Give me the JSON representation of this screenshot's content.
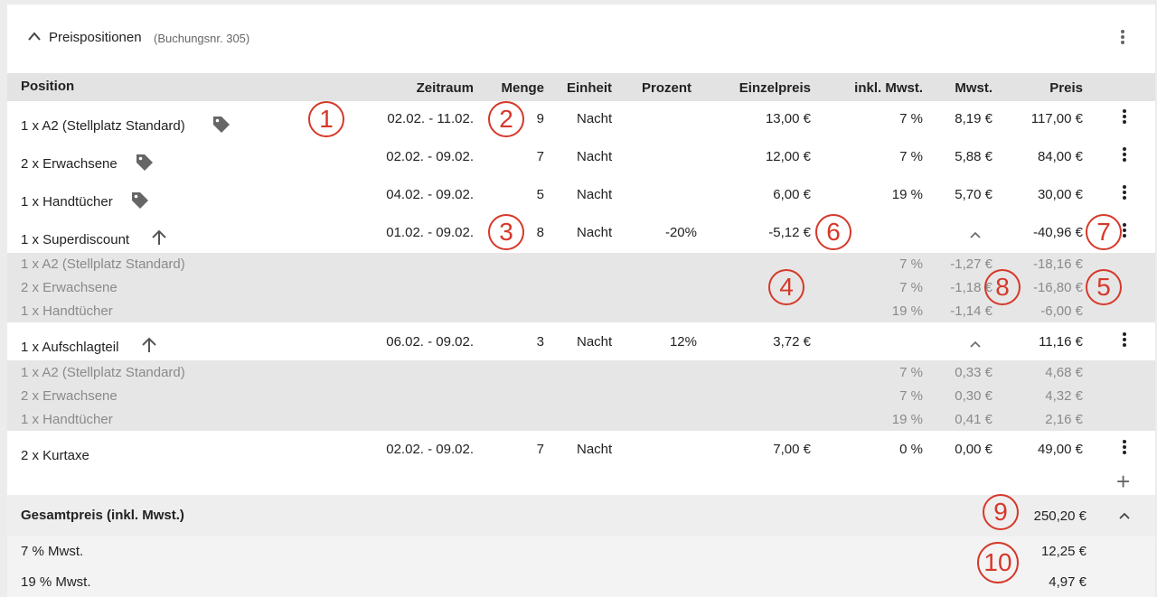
{
  "header": {
    "title": "Preispositionen",
    "subtitle": "(Buchungsnr. 305)"
  },
  "columns": {
    "position": "Position",
    "zeitraum": "Zeitraum",
    "menge": "Menge",
    "einheit": "Einheit",
    "prozent": "Prozent",
    "einzelpreis": "Einzelpreis",
    "inkl": "inkl. Mwst.",
    "mwst": "Mwst.",
    "preis": "Preis"
  },
  "rows": [
    {
      "pos": "1 x A2 (Stellplatz Standard)",
      "zeitraum": "02.02. - 11.02.",
      "menge": "9",
      "einheit": "Nacht",
      "prozent": "",
      "einzelpreis": "13,00 €",
      "inkl": "7 %",
      "mwst": "8,19 €",
      "preis": "117,00 €"
    },
    {
      "pos": "2 x Erwachsene",
      "zeitraum": "02.02. - 09.02.",
      "menge": "7",
      "einheit": "Nacht",
      "prozent": "",
      "einzelpreis": "12,00 €",
      "inkl": "7 %",
      "mwst": "5,88 €",
      "preis": "84,00 €"
    },
    {
      "pos": "1 x Handtücher",
      "zeitraum": "04.02. - 09.02.",
      "menge": "5",
      "einheit": "Nacht",
      "prozent": "",
      "einzelpreis": "6,00 €",
      "inkl": "19 %",
      "mwst": "5,70 €",
      "preis": "30,00 €"
    },
    {
      "pos": "1 x Superdiscount",
      "zeitraum": "01.02. - 09.02.",
      "menge": "8",
      "einheit": "Nacht",
      "prozent": "-20%",
      "einzelpreis": "-5,12 €",
      "inkl": "",
      "mwst": "",
      "preis": "-40,96 €"
    },
    {
      "pos": "1 x Aufschlagteil",
      "zeitraum": "06.02. - 09.02.",
      "menge": "3",
      "einheit": "Nacht",
      "prozent": "12%",
      "einzelpreis": "3,72 €",
      "inkl": "",
      "mwst": "",
      "preis": "11,16 €"
    },
    {
      "pos": "2 x Kurtaxe",
      "zeitraum": "02.02. - 09.02.",
      "menge": "7",
      "einheit": "Nacht",
      "prozent": "",
      "einzelpreis": "7,00 €",
      "inkl": "0 %",
      "mwst": "0,00 €",
      "preis": "49,00 €"
    }
  ],
  "discount_sub": [
    {
      "pos": "1 x A2 (Stellplatz Standard)",
      "inkl": "7 %",
      "mwst": "-1,27 €",
      "preis": "-18,16 €"
    },
    {
      "pos": "2 x Erwachsene",
      "inkl": "7 %",
      "mwst": "-1,18 €",
      "preis": "-16,80 €"
    },
    {
      "pos": "1 x Handtücher",
      "inkl": "19 %",
      "mwst": "-1,14 €",
      "preis": "-6,00 €"
    }
  ],
  "surcharge_sub": [
    {
      "pos": "1 x A2 (Stellplatz Standard)",
      "inkl": "7 %",
      "mwst": "0,33 €",
      "preis": "4,68 €"
    },
    {
      "pos": "2 x Erwachsene",
      "inkl": "7 %",
      "mwst": "0,30 €",
      "preis": "4,32 €"
    },
    {
      "pos": "1 x Handtücher",
      "inkl": "19 %",
      "mwst": "0,41 €",
      "preis": "2,16 €"
    }
  ],
  "add_label": "+",
  "total": {
    "label": "Gesamtpreis (inkl. Mwst.)",
    "value": "250,20 €"
  },
  "taxes": [
    {
      "label": "7 % Mwst.",
      "value": "12,25 €"
    },
    {
      "label": "19 % Mwst.",
      "value": "4,97 €"
    }
  ],
  "annotations": [
    "1",
    "2",
    "3",
    "4",
    "5",
    "6",
    "7",
    "8",
    "9",
    "10"
  ],
  "colors": {
    "annotation": "#d6382a",
    "header_bg": "#e3e3e3",
    "sub_bg": "#e6e6e6"
  }
}
